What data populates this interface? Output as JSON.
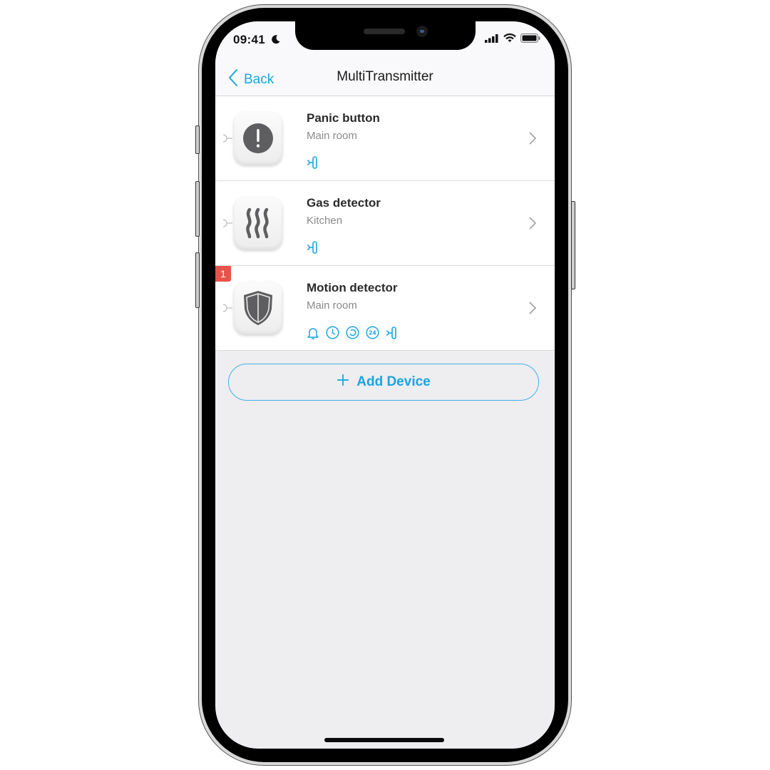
{
  "status_bar": {
    "time": "09:41",
    "focus_icon": "moon-icon",
    "icons": [
      "cellular-signal-icon",
      "wifi-icon",
      "battery-icon"
    ]
  },
  "nav": {
    "back_label": "Back",
    "title": "MultiTransmitter"
  },
  "devices": [
    {
      "name": "Panic button",
      "room": "Main room",
      "icon": "panic-button-icon",
      "badge": null,
      "status_icons": [
        "wired-connection-icon"
      ]
    },
    {
      "name": "Gas detector",
      "room": "Kitchen",
      "icon": "gas-detector-icon",
      "badge": null,
      "status_icons": [
        "wired-connection-icon"
      ]
    },
    {
      "name": "Motion detector",
      "room": "Main room",
      "icon": "shield-icon",
      "badge": "1",
      "status_icons": [
        "bell-icon",
        "delay-clock-icon",
        "sync-icon",
        "24h-zone-icon",
        "wired-connection-icon"
      ]
    }
  ],
  "add_device": {
    "label": "Add Device",
    "icon": "plus-icon"
  },
  "colors": {
    "accent": "#1aa5df",
    "badge": "#e9524a",
    "background": "#eeedf0"
  }
}
